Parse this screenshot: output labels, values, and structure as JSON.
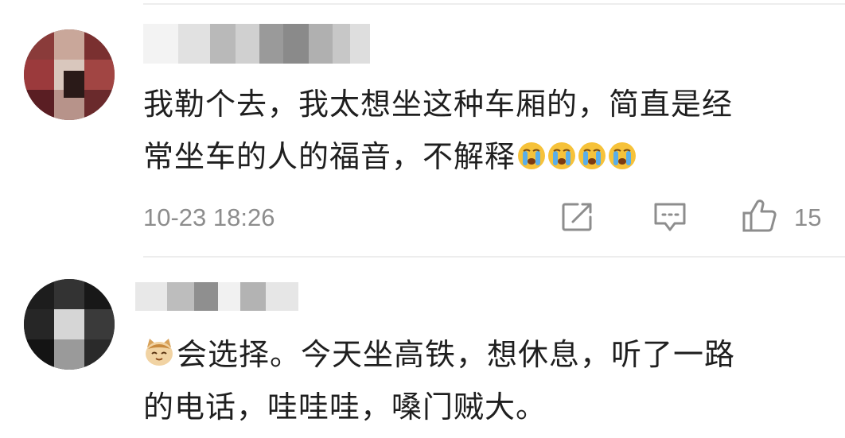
{
  "comments": [
    {
      "text_line1": "我勒个去，我太想坐这种车厢的，简直是经",
      "text_line2": "常坐车的人的福音，不解释",
      "emojis": [
        "crying-emoji",
        "crying-emoji",
        "crying-emoji",
        "crying-emoji"
      ],
      "timestamp": "10-23 18:26",
      "like_count": "15"
    },
    {
      "leading_emoji": "cat-emoji",
      "text_line1": "会选择。今天坐高铁，想休息，听了一路",
      "text_line2": "的电话，哇哇哇，嗓门贼大。"
    }
  ],
  "colors": {
    "text": "#1f1f1f",
    "meta": "#8d8d8d",
    "divider": "#ededed"
  }
}
